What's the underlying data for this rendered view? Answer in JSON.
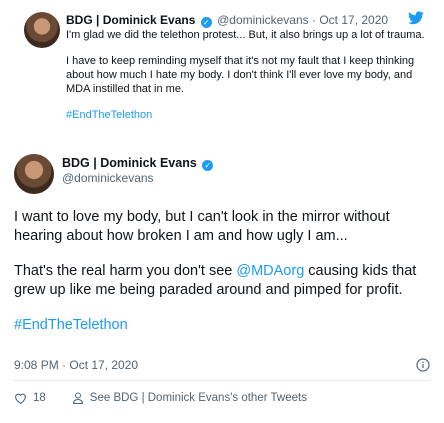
{
  "quoted": {
    "name": "BDG | Dominick Evans",
    "handle": "@dominickevans",
    "sep": "·",
    "date": "Oct 17, 2020",
    "paragraphs": [
      "I'm glad we did the telethon protest... But, it also brings up a lot of trauma.",
      "I have to keep reminding myself that it's not my fault that I keep thinking about how much I hate my body. I don't think I'll ever love my body, and MDA instilled that in me."
    ],
    "hashtag": "#EndTheTelethon"
  },
  "main": {
    "name": "BDG | Dominick Evans",
    "handle": "@dominickevans",
    "p1": "I want to love my body, but I can't look in the mirror without hearing about how broken I am and how ugly I am...",
    "p2_pre": "That's the real harm you don't see ",
    "p2_mention": "@MDAorg",
    "p2_post": " causing kids that grew up like me being paraded around and pimped for profit.",
    "hashtag": "#EndTheTelethon",
    "timestamp": "9:08 PM · Oct 17, 2020"
  },
  "footer": {
    "likes": "18",
    "see_more": "See BDG | Dominick Evans's other Tweets"
  },
  "colors": {
    "accent": "#1d9bf0",
    "muted": "#536471"
  }
}
